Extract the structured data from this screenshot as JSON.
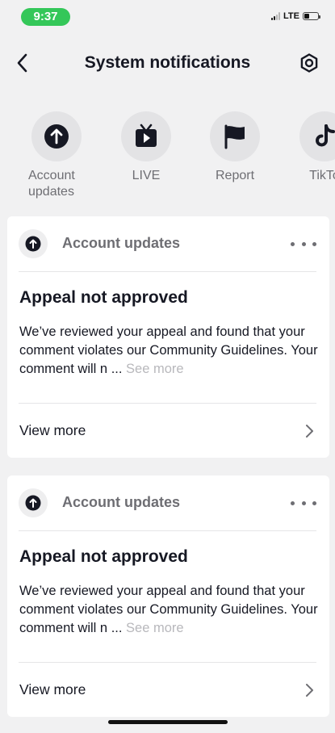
{
  "status_bar": {
    "time": "9:37",
    "network": "LTE"
  },
  "header": {
    "title": "System notifications"
  },
  "categories": [
    {
      "label": "Account updates",
      "icon": "arrow-up-circle-icon"
    },
    {
      "label": "LIVE",
      "icon": "live-tv-icon"
    },
    {
      "label": "Report",
      "icon": "flag-icon"
    },
    {
      "label": "TikTo",
      "icon": "tiktok-logo-icon"
    }
  ],
  "notifications": [
    {
      "source": "Account updates",
      "title": "Appeal not approved",
      "body": "We’ve reviewed your appeal and found that your comment violates our Community Guidelines. Your comment will n ...",
      "see_more": "See more",
      "view_more": "View more"
    },
    {
      "source": "Account updates",
      "title": "Appeal not approved",
      "body": "We’ve reviewed your appeal and found that your comment violates our Community Guidelines. Your comment will n ...",
      "see_more": "See more",
      "view_more": "View more"
    }
  ],
  "colors": {
    "status_pill": "#34c759",
    "background": "#f1f1f2",
    "card": "#ffffff",
    "muted_text": "#6e6e73"
  }
}
